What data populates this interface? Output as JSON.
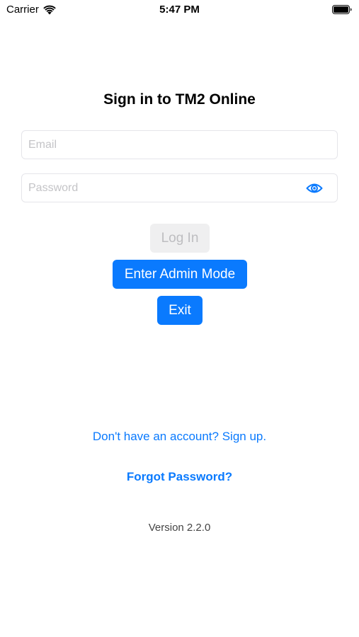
{
  "status_bar": {
    "carrier": "Carrier",
    "time": "5:47 PM"
  },
  "title": "Sign in to TM2 Online",
  "email": {
    "placeholder": "Email",
    "value": ""
  },
  "password": {
    "placeholder": "Password",
    "value": ""
  },
  "buttons": {
    "login": "Log In",
    "admin": "Enter Admin Mode",
    "exit": "Exit"
  },
  "links": {
    "signup": "Don't have an account? Sign up.",
    "forgot": "Forgot Password?"
  },
  "version": "Version 2.2.0",
  "colors": {
    "accent": "#0a7afe",
    "disabled_bg": "#efeff0",
    "disabled_text": "#bdbdc0"
  },
  "icons": {
    "wifi": "wifi-icon",
    "battery": "battery-icon",
    "password_toggle": "eye-icon"
  }
}
